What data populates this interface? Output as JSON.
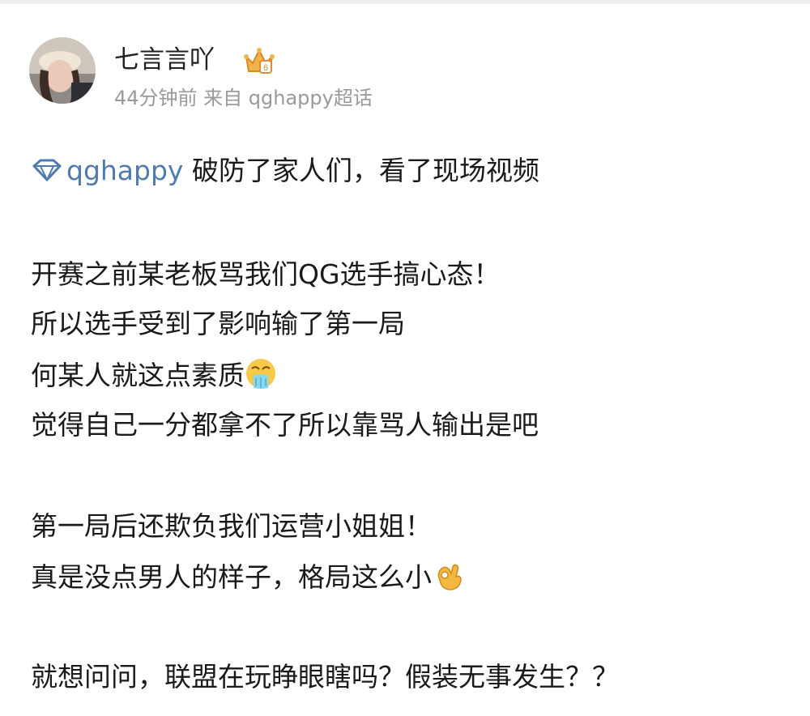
{
  "post": {
    "author": "七言言吖",
    "meta": "44分钟前 来自 qghappy超话",
    "topic": "qghappy",
    "topic_tail": "破防了家人们，看了现场视频",
    "lines": [
      "开赛之前某老板骂我们QG选手搞心态！",
      "所以选手受到了影响输了第一局",
      "何某人就这点素质",
      "觉得自己一分都拿不了所以靠骂人输出是吧",
      "第一局后还欺负我们运营小姐姐！",
      "真是没点男人的样子，格局这么小",
      "就想问问，联盟在玩睁眼瞎吗？假装无事发生？？"
    ]
  },
  "icons": {
    "avatar": "avatar",
    "badge": "crown-icon",
    "topic": "diamond-icon",
    "emoji_1": "vomit-emoji-icon",
    "emoji_2": "ok-hand-emoji-icon"
  },
  "colors": {
    "topic_link": "#4f7cb0",
    "meta": "#9a9a9a",
    "crown": "#e8a63a"
  }
}
